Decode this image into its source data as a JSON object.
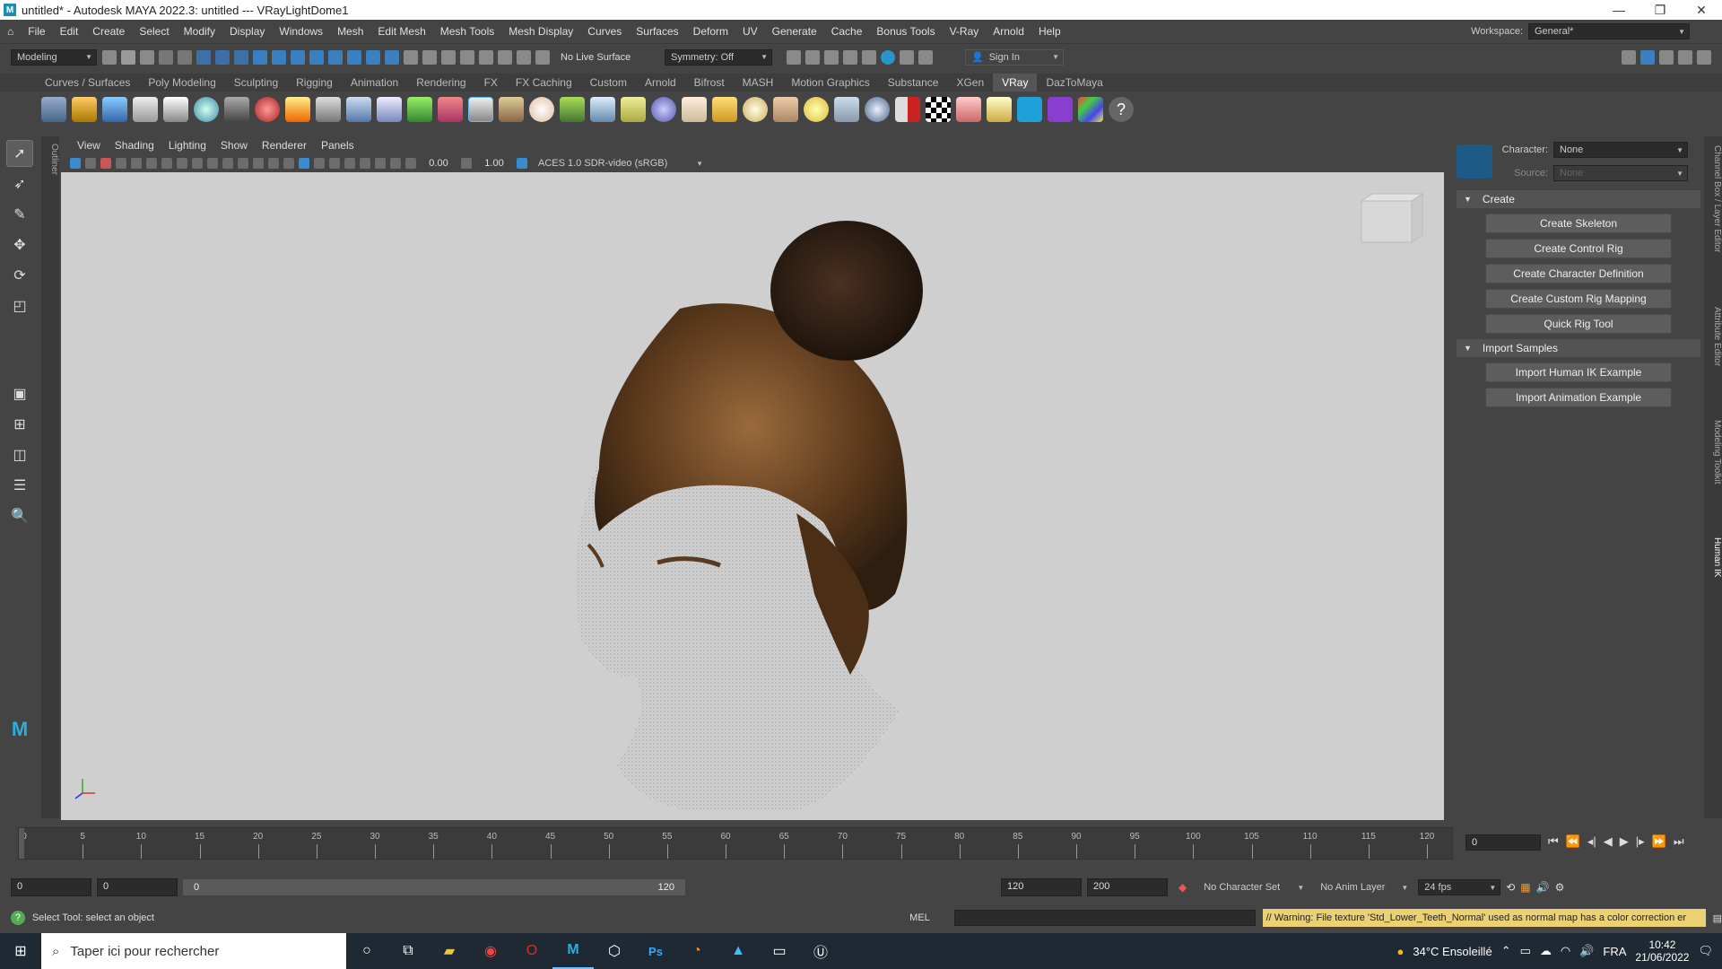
{
  "window": {
    "title": "untitled* - Autodesk MAYA 2022.3: untitled  ---  VRayLightDome1"
  },
  "menu": [
    "File",
    "Edit",
    "Create",
    "Select",
    "Modify",
    "Display",
    "Windows",
    "Mesh",
    "Edit Mesh",
    "Mesh Tools",
    "Mesh Display",
    "Curves",
    "Surfaces",
    "Deform",
    "UV",
    "Generate",
    "Cache",
    "Bonus Tools",
    "V-Ray",
    "Arnold",
    "Help"
  ],
  "workspace": {
    "label": "Workspace:",
    "value": "General*"
  },
  "statusline": {
    "mode": "Modeling",
    "live_surface": "No Live Surface",
    "symmetry": "Symmetry: Off",
    "sign_in": "Sign In"
  },
  "shelf_tabs": [
    "Curves / Surfaces",
    "Poly Modeling",
    "Sculpting",
    "Rigging",
    "Animation",
    "Rendering",
    "FX",
    "FX Caching",
    "Custom",
    "Arnold",
    "Bifrost",
    "MASH",
    "Motion Graphics",
    "Substance",
    "XGen",
    "VRay",
    "DazToMaya"
  ],
  "shelf_active": "VRay",
  "panel_menu": [
    "View",
    "Shading",
    "Lighting",
    "Show",
    "Renderer",
    "Panels"
  ],
  "panel_toolbar": {
    "exposure": "0.00",
    "gamma": "1.00",
    "colorspace": "ACES 1.0 SDR-video (sRGB)"
  },
  "outliner_label": "Outliner",
  "hik": {
    "character_label": "Character:",
    "character_value": "None",
    "source_label": "Source:",
    "source_value": "None",
    "sections": [
      {
        "title": "Create",
        "buttons": [
          "Create Skeleton",
          "Create Control Rig",
          "Create Character Definition",
          "Create Custom Rig Mapping",
          "Quick Rig Tool"
        ]
      },
      {
        "title": "Import Samples",
        "buttons": [
          "Import Human IK Example",
          "Import Animation Example"
        ]
      }
    ]
  },
  "right_strip": [
    "Channel Box / Layer Editor",
    "Attribute Editor",
    "Modeling Toolkit",
    "Human IK"
  ],
  "timeline": {
    "ticks": [
      "5",
      "10",
      "15",
      "20",
      "25",
      "30",
      "35",
      "40",
      "45",
      "50",
      "55",
      "60",
      "65",
      "70",
      "75",
      "80",
      "85",
      "90",
      "95",
      "100",
      "105",
      "110",
      "115",
      "120"
    ],
    "start_label": "0",
    "current": "0"
  },
  "range": {
    "start": "0",
    "anim_start": "0",
    "range_start": "0",
    "range_end": "120",
    "end": "120",
    "anim_end": "200",
    "char_set": "No Character Set",
    "anim_layer": "No Anim Layer",
    "fps": "24 fps"
  },
  "cmd": {
    "help": "Select Tool: select an object",
    "lang": "MEL",
    "warning": "// Warning: File texture 'Std_Lower_Teeth_Normal' used as normal map has a color correction er"
  },
  "taskbar": {
    "search_placeholder": "Taper ici pour rechercher",
    "weather": "34°C  Ensoleillé",
    "lang": "FRA",
    "time": "10:42",
    "date": "21/06/2022"
  }
}
